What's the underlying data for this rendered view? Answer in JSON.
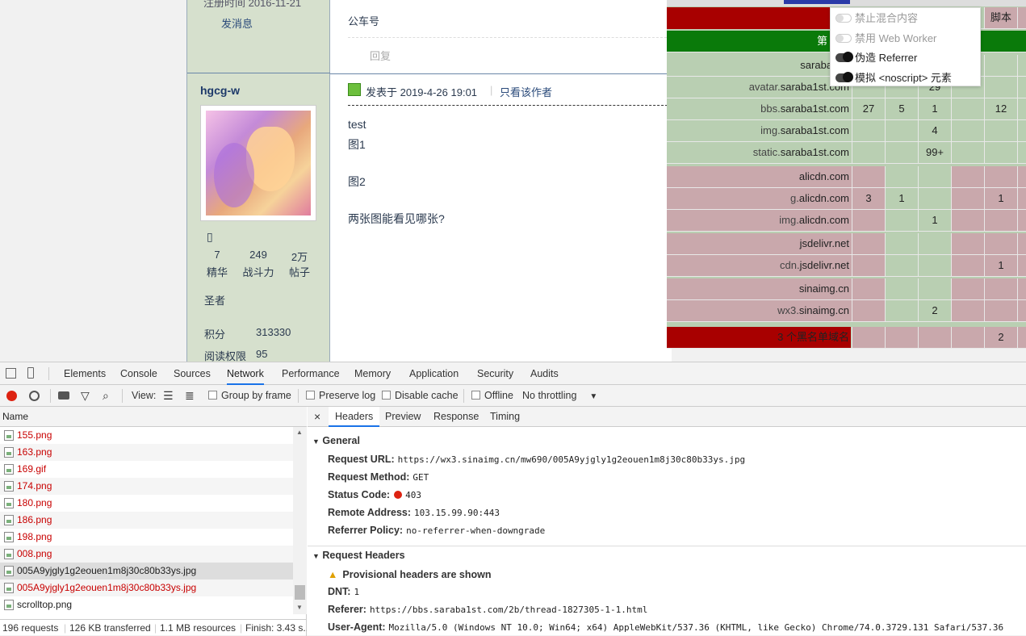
{
  "forum": {
    "reg_time": "注册时间   2016-11-21",
    "send_msg": "发消息",
    "prev_post_text": "公车号",
    "reply": "回复",
    "username": "hgcg-w",
    "stats": [
      {
        "num": "7",
        "label": "精华"
      },
      {
        "num": "249",
        "label": "战斗力"
      },
      {
        "num": "2万",
        "label": "帖子"
      }
    ],
    "rank": "圣者",
    "points_label": "积分",
    "points_value": "313330",
    "read_label": "阅读权限",
    "read_value": "95",
    "post_meta": "发表于 2019-4-26 19:01",
    "only_author": "只看该作者",
    "body": [
      "test",
      "图1",
      "图2",
      "两张图能看见哪张?"
    ]
  },
  "blocker": {
    "header_cell": "脚本",
    "partial_label": "第",
    "popup": [
      {
        "label": "禁止混合内容",
        "on": false
      },
      {
        "label": "禁用 Web Worker",
        "on": false
      },
      {
        "label": "伪造 Referrer",
        "on": true
      },
      {
        "label": "模拟 <noscript> 元素",
        "on": true
      }
    ],
    "rows": [
      {
        "sub": "",
        "base": "saraba1st.",
        "color": "green",
        "cells": [
          "",
          "",
          "",
          "",
          "",
          ""
        ]
      },
      {
        "sub": "avatar.",
        "base": "saraba1st.com",
        "color": "green",
        "cells": [
          "",
          "",
          "29",
          "",
          "",
          ""
        ]
      },
      {
        "sub": "bbs.",
        "base": "saraba1st.com",
        "color": "green",
        "cells": [
          "27",
          "5",
          "1",
          "",
          "12",
          ""
        ]
      },
      {
        "sub": "img.",
        "base": "saraba1st.com",
        "color": "green",
        "cells": [
          "",
          "",
          "4",
          "",
          "",
          ""
        ]
      },
      {
        "sub": "static.",
        "base": "saraba1st.com",
        "color": "green",
        "cells": [
          "",
          "",
          "99+",
          "",
          "",
          ""
        ]
      },
      {
        "sub": "",
        "base": "alicdn.com",
        "color": "pink",
        "cells": [
          "",
          "",
          "",
          "",
          "",
          ""
        ]
      },
      {
        "sub": "g.",
        "base": "alicdn.com",
        "color": "pink",
        "cells": [
          "3",
          "1",
          "",
          "",
          "1",
          ""
        ]
      },
      {
        "sub": "img.",
        "base": "alicdn.com",
        "color": "pink",
        "cells": [
          "",
          "",
          "1",
          "",
          "",
          ""
        ]
      },
      {
        "sub": "",
        "base": "jsdelivr.net",
        "color": "pink",
        "cells": [
          "",
          "",
          "",
          "",
          "",
          ""
        ]
      },
      {
        "sub": "cdn.",
        "base": "jsdelivr.net",
        "color": "pink",
        "cells": [
          "",
          "",
          "",
          "",
          "1",
          ""
        ]
      },
      {
        "sub": "",
        "base": "sinaimg.cn",
        "color": "pink",
        "cells": [
          "",
          "",
          "",
          "",
          "",
          ""
        ]
      },
      {
        "sub": "wx3.",
        "base": "sinaimg.cn",
        "color": "pink",
        "cells": [
          "",
          "",
          "2",
          "",
          "",
          ""
        ]
      }
    ],
    "footer_label": "3 个黑名单域名",
    "footer_cells": [
      "",
      "",
      "",
      "",
      "2",
      ""
    ]
  },
  "devtools": {
    "tabs": [
      "Elements",
      "Console",
      "Sources",
      "Network",
      "Performance",
      "Memory",
      "Application",
      "Security",
      "Audits"
    ],
    "active_tab": "Network",
    "toolbar": {
      "view": "View:",
      "group_by_frame": "Group by frame",
      "preserve_log": "Preserve log",
      "disable_cache": "Disable cache",
      "offline": "Offline",
      "throttling": "No throttling"
    },
    "name_header": "Name",
    "requests": [
      {
        "name": "155.png",
        "style": "err"
      },
      {
        "name": "163.png",
        "style": "err"
      },
      {
        "name": "169.gif",
        "style": "err"
      },
      {
        "name": "174.png",
        "style": "err"
      },
      {
        "name": "180.png",
        "style": "err"
      },
      {
        "name": "186.png",
        "style": "err"
      },
      {
        "name": "198.png",
        "style": "err"
      },
      {
        "name": "008.png",
        "style": "err"
      },
      {
        "name": "005A9yjgly1g2eouen1m8j30c80b33ys.jpg",
        "style": "sel"
      },
      {
        "name": "005A9yjgly1g2eouen1m8j30c80b33ys.jpg",
        "style": "err"
      },
      {
        "name": "scrolltop.png",
        "style": "plain"
      }
    ],
    "status": {
      "requests": "196 requests",
      "transferred": "126 KB transferred",
      "resources": "1.1 MB resources",
      "finish": "Finish: 3.43 s..."
    },
    "detail_tabs": [
      "Headers",
      "Preview",
      "Response",
      "Timing"
    ],
    "general_title": "General",
    "general": [
      {
        "k": "Request URL:",
        "v": "https://wx3.sinaimg.cn/mw690/005A9yjgly1g2eouen1m8j30c80b33ys.jpg"
      },
      {
        "k": "Request Method:",
        "v": "GET"
      },
      {
        "k": "Status Code:",
        "v": "403"
      },
      {
        "k": "Remote Address:",
        "v": "103.15.99.90:443"
      },
      {
        "k": "Referrer Policy:",
        "v": "no-referrer-when-downgrade"
      }
    ],
    "req_headers_title": "Request Headers",
    "provisional": "Provisional headers are shown",
    "req_headers": [
      {
        "k": "DNT:",
        "v": "1"
      },
      {
        "k": "Referer:",
        "v": "https://bbs.saraba1st.com/2b/thread-1827305-1-1.html"
      },
      {
        "k": "User-Agent:",
        "v": "Mozilla/5.0 (Windows NT 10.0; Win64; x64) AppleWebKit/537.36 (KHTML, like Gecko) Chrome/74.0.3729.131 Safari/537.36"
      }
    ]
  }
}
